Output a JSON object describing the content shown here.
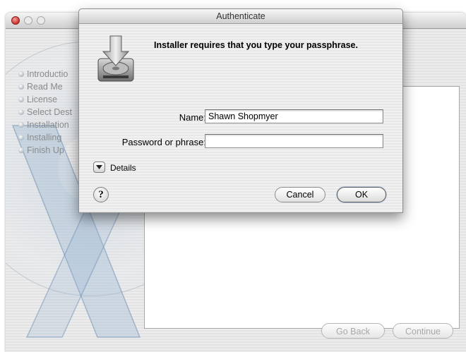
{
  "installer": {
    "steps": [
      "Introductio",
      "Read Me",
      "License",
      "Select Dest",
      "Installation",
      "Installing",
      "Finish Up"
    ],
    "buttons": {
      "go_back": "Go Back",
      "continue": "Continue"
    }
  },
  "dialog": {
    "title": "Authenticate",
    "message": "Installer requires that you type your passphrase.",
    "name_label": "Name:",
    "name_value": "Shawn Shopmyer",
    "password_label": "Password or phrase:",
    "password_value": "",
    "details_label": "Details",
    "help_label": "?",
    "cancel_label": "Cancel",
    "ok_label": "OK"
  },
  "icons": {
    "window_close": "close-icon",
    "installer_disk": "installer-disk-icon",
    "disclosure": "disclosure-triangle-icon",
    "help": "help-icon"
  },
  "colors": {
    "close_red": "#c9302c",
    "disabled_text": "#a8a8a8"
  }
}
